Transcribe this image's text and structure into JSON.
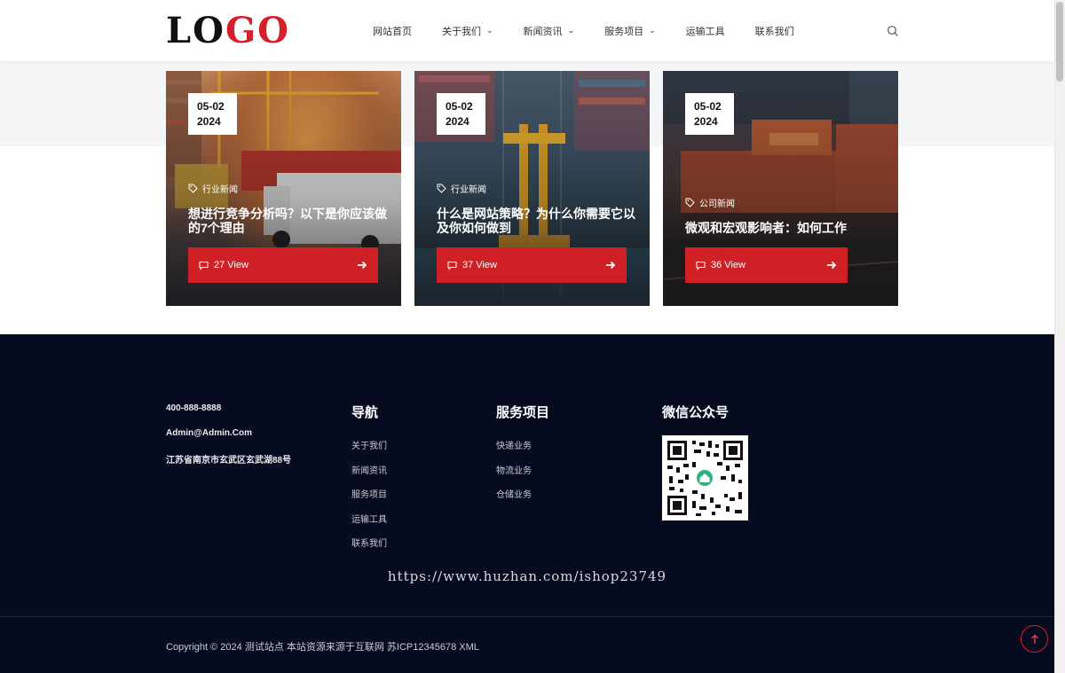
{
  "header": {
    "logo": {
      "part1": "LO",
      "part2": "GO"
    },
    "nav": [
      {
        "label": "网站首页",
        "dropdown": false
      },
      {
        "label": "关于我们",
        "dropdown": true
      },
      {
        "label": "新闻资讯",
        "dropdown": true
      },
      {
        "label": "服务项目",
        "dropdown": true
      },
      {
        "label": "运输工具",
        "dropdown": false
      },
      {
        "label": "联系我们",
        "dropdown": false
      }
    ],
    "search_icon": "search-icon"
  },
  "cards": [
    {
      "date_line1": "05-02",
      "date_line2": "2024",
      "tag": "行业新闻",
      "title": "想进行竞争分析吗？以下是你应该做的7个理由",
      "views": "27 View"
    },
    {
      "date_line1": "05-02",
      "date_line2": "2024",
      "tag": "行业新闻",
      "title": "什么是网站策略？为什么你需要它以及你如何做到",
      "views": "37 View"
    },
    {
      "date_line1": "05-02",
      "date_line2": "2024",
      "tag": "公司新闻",
      "title": "微观和宏观影响者：如何工作",
      "views": "36 View"
    }
  ],
  "footer": {
    "phone": "400-888-8888",
    "email": "Admin@Admin.Com",
    "address": "江苏省南京市玄武区玄武湖88号",
    "nav_title": "导航",
    "nav_links": [
      "关于我们",
      "新闻资讯",
      "服务项目",
      "运输工具",
      "联系我们"
    ],
    "services_title": "服务项目",
    "services_links": [
      "快递业务",
      "物流业务",
      "仓储业务"
    ],
    "wechat_title": "微信公众号",
    "watermark": "https://www.huzhan.com/ishop23749",
    "copyright": "Copyright © 2024 测试站点 本站资源来源于互联网 苏ICP12345678 XML"
  },
  "colors": {
    "accent": "#cf2026",
    "footer_bg": "#070b1f",
    "band": "#f4f5f7"
  }
}
